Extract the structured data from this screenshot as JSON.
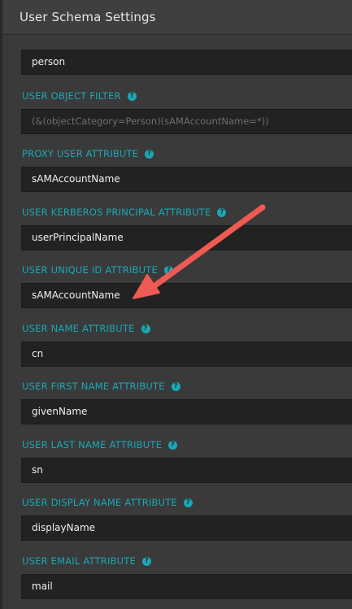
{
  "panel": {
    "title": "User Schema Settings"
  },
  "fields": [
    {
      "label": "",
      "value": "person"
    },
    {
      "label": "USER OBJECT FILTER",
      "placeholder": "(&(objectCategory=Person)(sAMAccountName=*))"
    },
    {
      "label": "PROXY USER ATTRIBUTE",
      "value": "sAMAccountName"
    },
    {
      "label": "USER KERBEROS PRINCIPAL ATTRIBUTE",
      "value": "userPrincipalName"
    },
    {
      "label": "USER UNIQUE ID ATTRIBUTE",
      "value": "sAMAccountName"
    },
    {
      "label": "USER NAME ATTRIBUTE",
      "value": "cn"
    },
    {
      "label": "USER FIRST NAME ATTRIBUTE",
      "value": "givenName"
    },
    {
      "label": "USER LAST NAME ATTRIBUTE",
      "value": "sn"
    },
    {
      "label": "USER DISPLAY NAME ATTRIBUTE",
      "value": "displayName"
    },
    {
      "label": "USER EMAIL ATTRIBUTE",
      "value": "mail"
    }
  ],
  "help_icon_glyph": "?",
  "colors": {
    "label": "#19a8b5",
    "arrow": "#ef5a52",
    "input_bg": "#222222",
    "panel_bg": "#3a3a3a"
  },
  "annotation": {
    "type": "arrow",
    "points_to": "user-unique-id-input"
  }
}
